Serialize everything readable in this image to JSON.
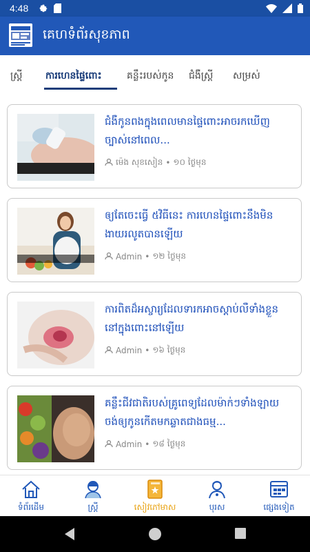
{
  "status": {
    "time": "4:48"
  },
  "app": {
    "title": "គេហទំព័រសុខភាព"
  },
  "tabs": [
    {
      "label": "ស្ត្រី"
    },
    {
      "label": "ការហេនផ្ទៃពោះ",
      "active": true
    },
    {
      "label": "គន្លឹះរបស់កូន"
    },
    {
      "label": "ជំងឺស្ត្រី"
    },
    {
      "label": "សម្រស់"
    }
  ],
  "articles": [
    {
      "title": "ជំងឺកូនពងក្នុងពេលមានផ្ទៃពោះអាចរកឃើញច្បាស់នៅពេល...",
      "author": "ម៉េង សុខសៀន",
      "time": "១០ ថ្ងៃមុន",
      "thumb_caption": "ជំងឺកូនពងក្នុងពេលមានផ្ទៃពោះ"
    },
    {
      "title": "ឲ្យតែចេះធ្វើ ៥វិធីនេះ ការហេនផ្ទៃពោះនឹងមិនងាយរលូតបានឡើយ",
      "author": "Admin",
      "time": "១២ ថ្ងៃមុន",
      "thumb_caption": "ការហេនផ្ទៃពោះ"
    },
    {
      "title": "ការពិតដ៏អស្ចារ្យដែលទារកអាចស្តាប់លឺទាំងខ្លួននៅក្នុងពោះនៅឡើយ",
      "author": "Admin",
      "time": "១៦ ថ្ងៃមុន"
    },
    {
      "title": "គន្លឹះជីវជាតិរបស់គ្រូពេទ្យដែលម៉ាក់ៗទាំងឡាយចង់ឲ្យកូនកើតមកឆ្លាតជាងធម្ម...",
      "author": "Admin",
      "time": "១៨ ថ្ងៃមុន"
    }
  ],
  "bottom_nav": [
    {
      "label": "ទំព័រដើម",
      "icon": "home-icon"
    },
    {
      "label": "ស្ត្រី",
      "icon": "woman-icon"
    },
    {
      "label": "សៀវភៅមាស",
      "icon": "book-icon",
      "active": true
    },
    {
      "label": "បុរស",
      "icon": "doctor-icon"
    },
    {
      "label": "ផ្សេងទៀត",
      "icon": "grid-icon"
    }
  ],
  "colors": {
    "primary": "#2158b8",
    "status_bar": "#1a4fa3",
    "active_tab": "#1a3d7a",
    "title_text": "#1a4cb8",
    "active_nav": "#e8a10f"
  }
}
